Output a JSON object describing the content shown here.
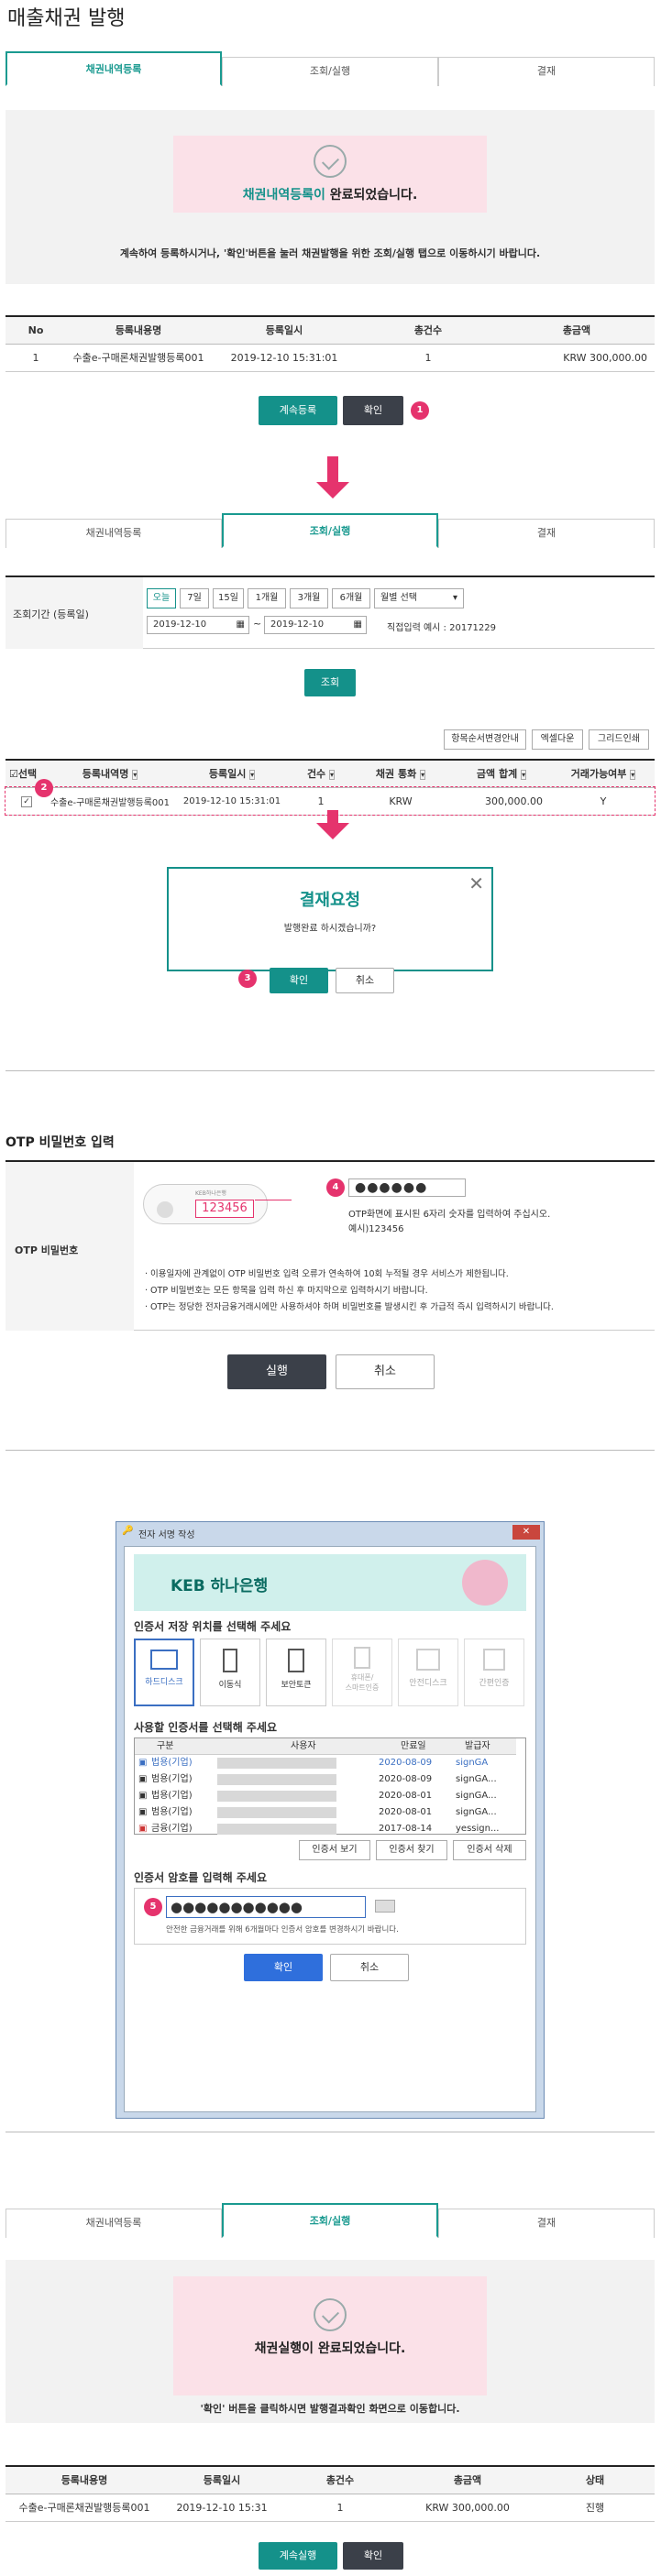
{
  "page_title": "매출채권 발행",
  "tabs": [
    "채권내역등록",
    "조회/실행",
    "결재"
  ],
  "section1": {
    "message_highlight": "채권내역등록이",
    "message_rest": " 완료되었습니다.",
    "info": "계속하여 등록하시거나, '확인'버튼을 눌러 채권발행을 위한 조회/실행 탭으로 이동하시기 바랍니다.",
    "table_headers": [
      "No",
      "등록내용명",
      "등록일시",
      "총건수",
      "총금액"
    ],
    "table_row": [
      "1",
      "수출e-구매론채권발행등록001",
      "2019-12-10 15:31:01",
      "1",
      "KRW 300,000.00"
    ],
    "btn_continue": "계속등록",
    "btn_confirm": "확인",
    "badge": "1"
  },
  "section2": {
    "period_label": "조회기간 (등록일)",
    "period_buttons": [
      "오늘",
      "7일",
      "15일",
      "1개월",
      "3개월",
      "6개월"
    ],
    "month_select": "월별 선택",
    "date_from": "2019-12-10",
    "date_to": "2019-12-10",
    "tilde": "~",
    "direct_input": "직접입력 예시 : 20171229",
    "search_btn": "조회",
    "tool_buttons": [
      "항목순서변경안내",
      "엑셀다운",
      "그리드인쇄"
    ],
    "table_headers": [
      "선택",
      "등록내역명",
      "등록일시",
      "건수",
      "채권 통화",
      "금액 합계",
      "거래가능여부"
    ],
    "table_row": [
      "수출e-구매론채권발행등록001",
      "2019-12-10 15:31:01",
      "1",
      "KRW",
      "300,000.00",
      "Y"
    ],
    "badge": "2"
  },
  "dialog": {
    "title": "결재요청",
    "message": "발행완료 하시겠습니까?",
    "btn_ok": "확인",
    "btn_cancel": "취소",
    "badge": "3"
  },
  "otp": {
    "section_title": "OTP 비밀번호 입력",
    "row_label": "OTP 비밀번호",
    "device_brand": "KEB하나은행",
    "device_number": "123456",
    "input_value": "●●●●●●",
    "hint1": "OTP화면에 표시된 6자리 숫자를 입력하여 주십시오.",
    "hint2": "예시)123456",
    "notes": [
      "· 이용일자에 관계없이 OTP 비밀번호 입력 오류가 연속하여 10회 누적될 경우 서비스가 제한됩니다.",
      "· OTP 비밀번호는 모든 항목을 입력 하신 후 마지막으로 입력하시기 바랍니다.",
      "· OTP는 정당한 전자금융거래시에만 사용하셔야 하며 비밀번호를 발생시킨 후 가급적 즉시 입력하시기 바랍니다."
    ],
    "btn_execute": "실행",
    "btn_cancel": "취소",
    "badge": "4"
  },
  "cert": {
    "window_title": "전자 서명 작성",
    "bank_name": "KEB 하나은행",
    "select_location": "인증서 저장 위치를 선택해 주세요",
    "locations": [
      "하드디스크",
      "이동식",
      "보안토큰",
      "휴대폰/\n스마트인증",
      "안전디스크",
      "간편인증"
    ],
    "select_cert": "사용할 인증서를 선택해 주세요",
    "cert_headers": [
      "구분",
      "사용자",
      "만료일",
      "발급자"
    ],
    "cert_rows": [
      [
        "법용(기업)",
        "2020-08-09",
        "signGA"
      ],
      [
        "범용(기업)",
        "2020-08-09",
        "signGA..."
      ],
      [
        "법용(기업)",
        "2020-08-01",
        "signGA..."
      ],
      [
        "범용(기업)",
        "2020-08-01",
        "signGA..."
      ],
      [
        "금융(기업)",
        "2017-08-14",
        "yessign..."
      ]
    ],
    "cert_buttons": [
      "인증서 보기",
      "인증서 찾기",
      "인증서 삭제"
    ],
    "password_label": "인증서 암호를 입력해 주세요",
    "password_value": "●●●●●●●●●●●",
    "password_note": "안전한 금융거래를 위해 6개월마다 인증서 암호를 변경하시기 바랍니다.",
    "btn_ok": "확인",
    "btn_cancel": "취소",
    "badge": "5"
  },
  "section3": {
    "message": "채권실행이 완료되었습니다.",
    "info": "'확인' 버튼을 클릭하시면 발행결과확인 화면으로 이동합니다.",
    "table_headers": [
      "등록내용명",
      "등록일시",
      "총건수",
      "총금액",
      "상태"
    ],
    "table_row": [
      "수출e-구매론채권발행등록001",
      "2019-12-10 15:31",
      "1",
      "KRW 300,000.00",
      "진행"
    ],
    "btn_continue": "계속실행",
    "btn_confirm": "확인"
  }
}
